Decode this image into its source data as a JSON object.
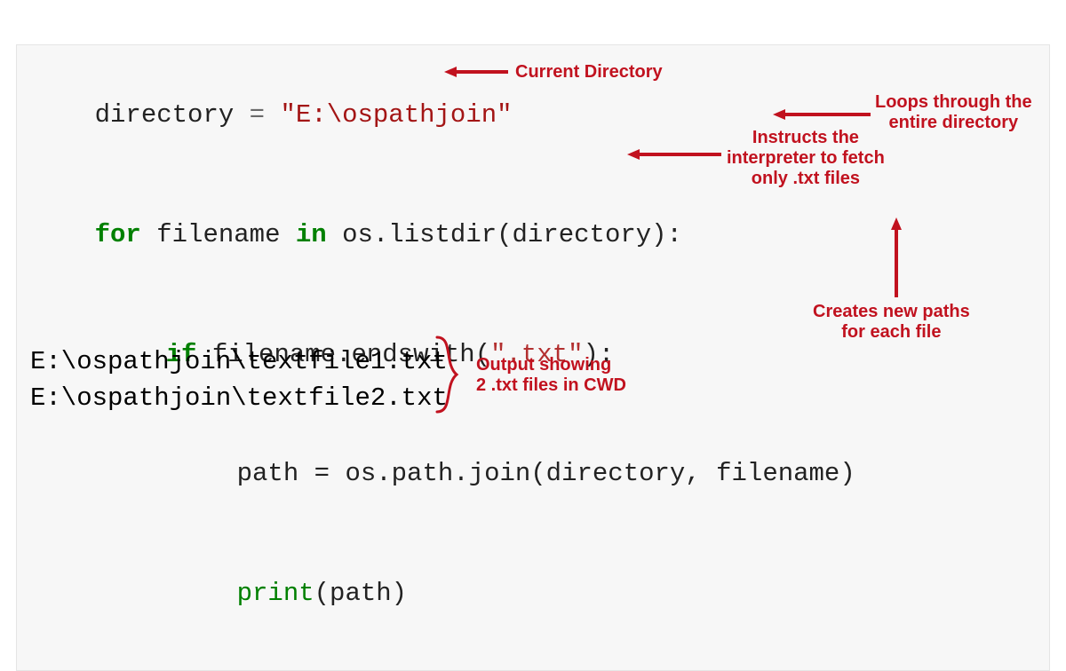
{
  "code": {
    "line1": {
      "var": "directory",
      "op": " = ",
      "str": "\"E:\\ospathjoin\""
    },
    "line2": {
      "kw1": "for",
      "mid": " filename ",
      "kw2": "in",
      "rest": " os.listdir(directory):"
    },
    "line3": {
      "kw": "if",
      "mid": " filename.endswith(",
      "str": "\".txt\"",
      "close": "):"
    },
    "line4": {
      "text": "path = os.path.join(directory, filename)"
    },
    "line5": {
      "fn": "print",
      "args": "(path)"
    }
  },
  "output": {
    "line1": "E:\\ospathjoin\\textfile1.txt",
    "line2": "E:\\ospathjoin\\textfile2.txt"
  },
  "annotations": {
    "a1": "Current Directory",
    "a2": "Loops through the\nentire directory",
    "a3": "Instructs the\ninterpreter to fetch\nonly .txt files",
    "a4": "Creates new paths\nfor each file",
    "a5": "Output showing\n2 .txt files in CWD"
  },
  "colors": {
    "annot": "#c1121f"
  }
}
